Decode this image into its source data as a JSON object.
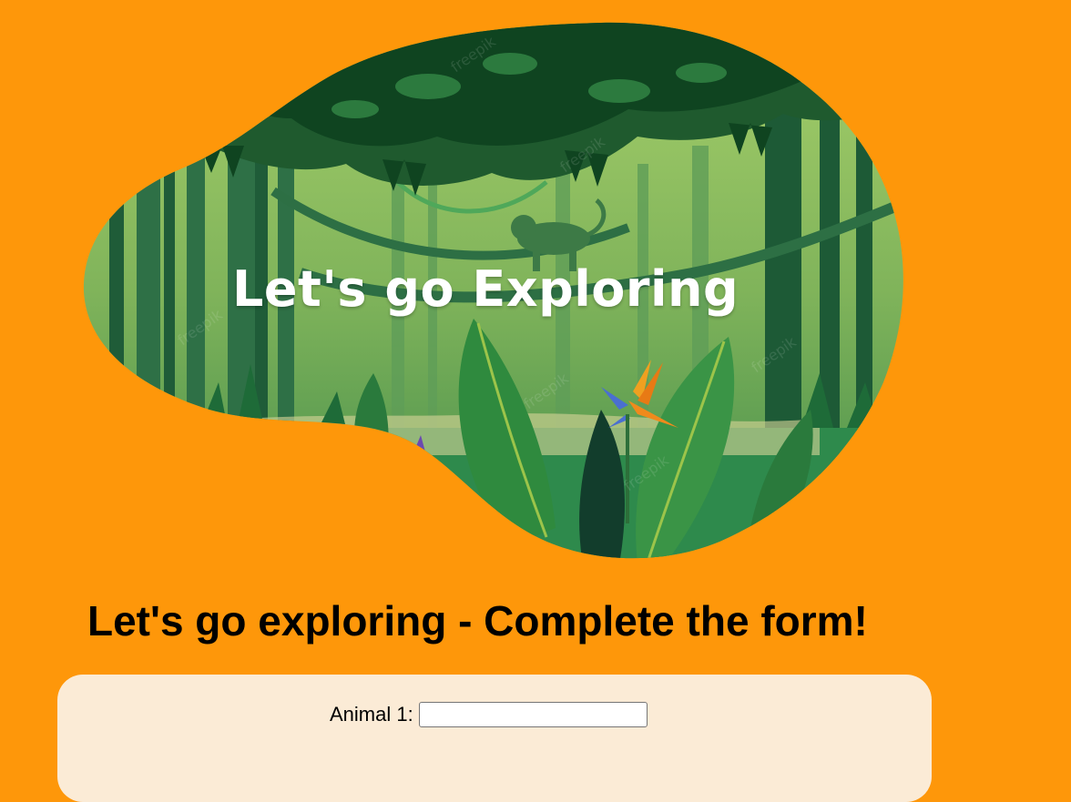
{
  "hero": {
    "title": "Let's go Exploring",
    "image": "jungle-illustration",
    "watermark": "freepik"
  },
  "form": {
    "heading": "Let's go exploring - Complete the form!",
    "fields": [
      {
        "label": "Animal 1:",
        "value": "",
        "placeholder": ""
      }
    ]
  },
  "colors": {
    "page_background": "#fe970a",
    "form_panel": "#fbebd6",
    "heading_text": "#000000",
    "hero_text": "#ffffff"
  }
}
